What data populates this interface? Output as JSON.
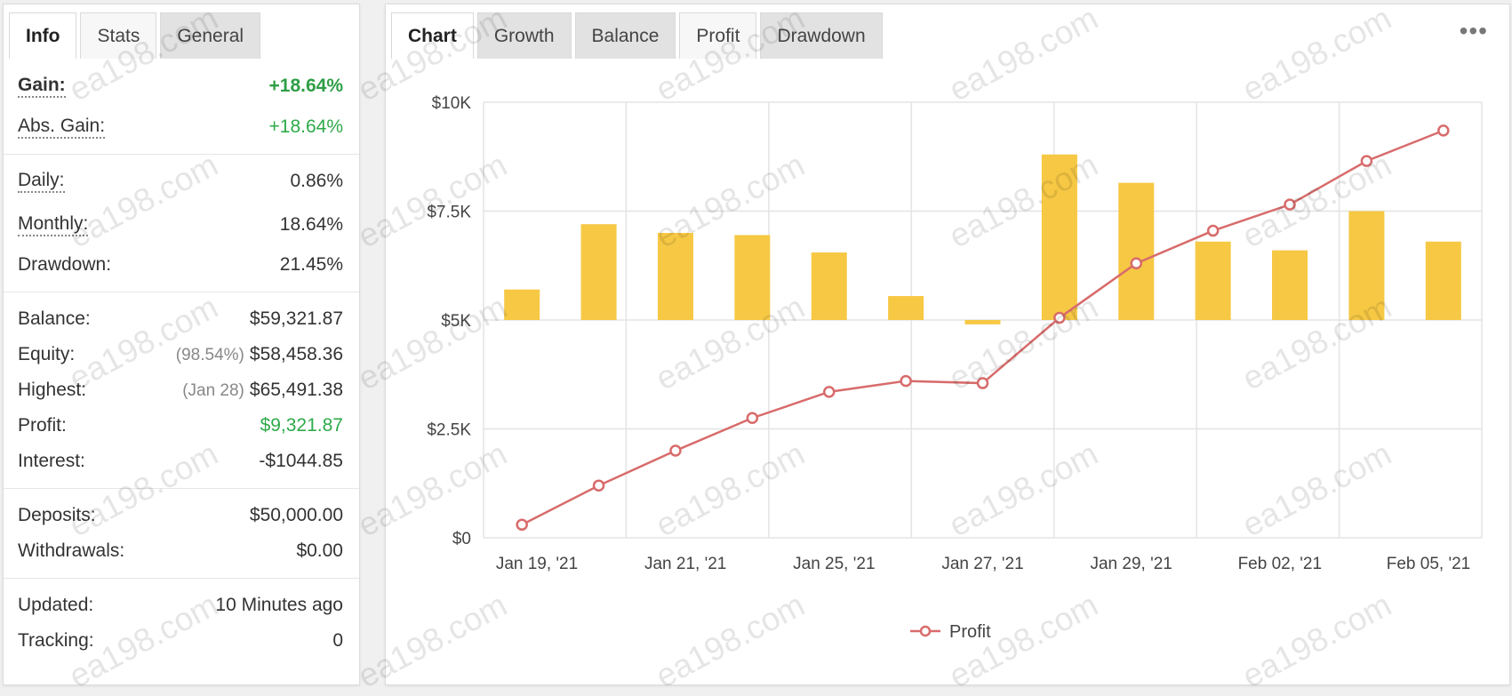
{
  "left_tabs": [
    {
      "label": "Info",
      "active": true
    },
    {
      "label": "Stats",
      "active": false
    },
    {
      "label": "General",
      "active": false
    }
  ],
  "stats": {
    "gain": {
      "label": "Gain:",
      "value": "+18.64%"
    },
    "abs_gain": {
      "label": "Abs. Gain:",
      "value": "+18.64%"
    },
    "daily": {
      "label": "Daily:",
      "value": "0.86%"
    },
    "monthly": {
      "label": "Monthly:",
      "value": "18.64%"
    },
    "drawdown": {
      "label": "Drawdown:",
      "value": "21.45%"
    },
    "balance": {
      "label": "Balance:",
      "value": "$59,321.87"
    },
    "equity": {
      "label": "Equity:",
      "prefix": "(98.54%)",
      "value": "$58,458.36"
    },
    "highest": {
      "label": "Highest:",
      "prefix": "(Jan 28)",
      "value": "$65,491.38"
    },
    "profit": {
      "label": "Profit:",
      "value": "$9,321.87"
    },
    "interest": {
      "label": "Interest:",
      "value": "-$1044.85"
    },
    "deposits": {
      "label": "Deposits:",
      "value": "$50,000.00"
    },
    "withdrawals": {
      "label": "Withdrawals:",
      "value": "$0.00"
    },
    "updated": {
      "label": "Updated:",
      "value": "10 Minutes ago"
    },
    "tracking": {
      "label": "Tracking:",
      "value": "0"
    }
  },
  "right_tabs": [
    {
      "label": "Chart",
      "active": true
    },
    {
      "label": "Growth",
      "active": false
    },
    {
      "label": "Balance",
      "active": false
    },
    {
      "label": "Profit",
      "active": false
    },
    {
      "label": "Drawdown",
      "active": false
    }
  ],
  "menu_icon": "more-dots-icon",
  "menu_glyph": "•••",
  "colors": {
    "green": "#2eaa4a",
    "bar": "#f6c844",
    "line": "#d86b6b"
  },
  "watermark": "ea198.com",
  "chart_data": {
    "type": "bar+line",
    "y_ticks": [
      "$0",
      "$2.5K",
      "$5K",
      "$7.5K",
      "$10K"
    ],
    "y_tick_values": [
      0,
      2500,
      5000,
      7500,
      10000
    ],
    "ylim": [
      0,
      10000
    ],
    "x_tick_labels": [
      "Jan 19, '21",
      "Jan 21, '21",
      "Jan 25, '21",
      "Jan 27, '21",
      "Jan 29, '21",
      "Feb 02, '21",
      "Feb 05, '21"
    ],
    "bar_baseline": 5000,
    "bars": [
      5700,
      7200,
      7000,
      6950,
      6550,
      5550,
      4900,
      8800,
      8150,
      6800,
      6600,
      7500,
      6800
    ],
    "series": [
      {
        "name": "Profit",
        "values": [
          300,
          1200,
          2000,
          2750,
          3350,
          3600,
          3550,
          5050,
          6300,
          7050,
          7650,
          8650,
          9350
        ]
      }
    ],
    "legend": {
      "label": "Profit",
      "position": "bottom-center"
    },
    "grid": true
  }
}
